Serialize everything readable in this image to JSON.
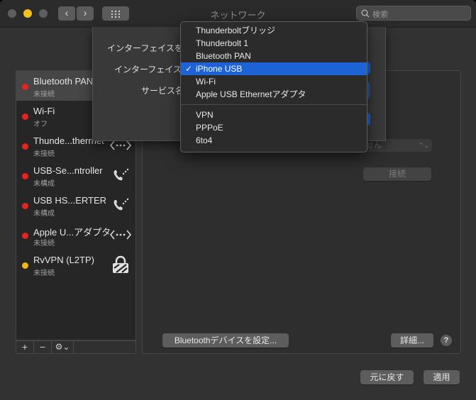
{
  "window": {
    "title": "ネットワーク"
  },
  "toolbar": {
    "back": "‹",
    "forward": "›",
    "search_placeholder": "検索"
  },
  "services": [
    {
      "name": "Bluetooth PAN",
      "status": "未接続",
      "dot": "#e8231f",
      "icon": "dots-arrows-icon"
    },
    {
      "name": "Wi-Fi",
      "status": "オフ",
      "dot": "#e8231f",
      "icon": ""
    },
    {
      "name": "Thunde...therrnet",
      "status": "未接続",
      "dot": "#e8231f",
      "icon": "dots-arrows-icon"
    },
    {
      "name": "USB-Se...ntroller",
      "status": "未構成",
      "dot": "#e8231f",
      "icon": "phone-icon"
    },
    {
      "name": "USB HS...ERTER",
      "status": "未構成",
      "dot": "#e8231f",
      "icon": "phone-icon"
    },
    {
      "name": "Apple U...アダプタ",
      "status": "未接続",
      "dot": "#e8231f",
      "icon": "dots-arrows-icon"
    },
    {
      "name": "RvVPN (L2TP)",
      "status": "未接続",
      "dot": "#f5b31c",
      "icon": "lock-icon"
    }
  ],
  "list_bar": {
    "add": "+",
    "remove": "−",
    "gear": "⚙⌄"
  },
  "pane": {
    "popup_fragment": "せん",
    "connect_button": "接続",
    "bt_setup_button": "Bluetoothデバイスを設定...",
    "advanced_button": "詳細...",
    "help": "?"
  },
  "footer": {
    "revert_button": "元に戻す",
    "apply_button": "適用"
  },
  "sheet": {
    "prompt_label": "インターフェイスを",
    "interface_label": "インターフェイス",
    "service_label": "サービス名"
  },
  "menu": {
    "group1": [
      "Thunderboltブリッジ",
      "Thunderbolt 1",
      "Bluetooth PAN",
      "iPhone USB",
      "Wi-Fi",
      "Apple USB Ethernetアダプタ"
    ],
    "group2": [
      "VPN",
      "PPPoE",
      "6to4"
    ],
    "selected": "iPhone USB",
    "checkmark": "✓"
  },
  "colors": {
    "highlight": "#1d63d6",
    "accent_blue": "#1d63d6"
  }
}
